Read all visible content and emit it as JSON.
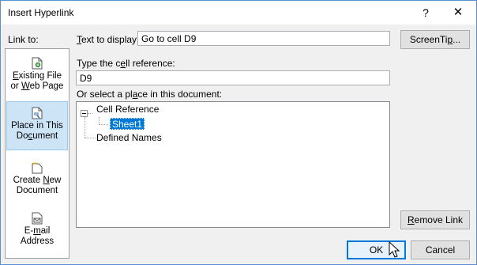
{
  "window": {
    "title": "Insert Hyperlink",
    "help_glyph": "?",
    "close_glyph": "✕"
  },
  "link_to": {
    "label": "Link to:",
    "items": [
      {
        "line1": "Existing File",
        "line2": "or Web Page",
        "icon": "existing-file-icon",
        "selected": false
      },
      {
        "line1": "Place in This",
        "line2": "Document",
        "icon": "place-in-document-icon",
        "selected": true
      },
      {
        "line1": "Create New",
        "line2": "Document",
        "icon": "create-new-document-icon",
        "selected": false
      },
      {
        "line1": "E-mail",
        "line2": "Address",
        "icon": "email-address-icon",
        "selected": false
      }
    ]
  },
  "text_to_display": {
    "label": "Text to display:",
    "value": "Go to cell D9"
  },
  "screentip_button": "ScreenTip...",
  "cell_reference": {
    "label": "Type the cell reference:",
    "value": "D9"
  },
  "place_select_label": "Or select a place in this document:",
  "tree": {
    "root": "Cell Reference",
    "child": "Sheet1",
    "second_root": "Defined Names"
  },
  "remove_link_button": "Remove Link",
  "ok_button": "OK",
  "cancel_button": "Cancel",
  "colors": {
    "selection": "#0078d7",
    "sidebar_selected": "#cde4f7",
    "window_border": "#5a8fd0"
  }
}
